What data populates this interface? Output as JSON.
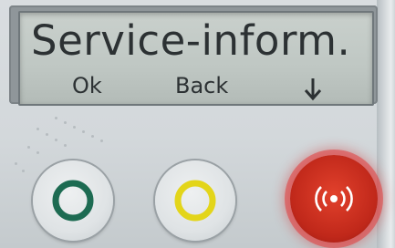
{
  "display": {
    "title": "Service-inform.",
    "softkeys": {
      "ok": "Ok",
      "back": "Back",
      "down_icon": "arrow-down-icon"
    }
  },
  "buttons": {
    "green": {
      "icon": "circle-icon",
      "color": "#1d6b52"
    },
    "yellow": {
      "icon": "circle-icon",
      "color": "#e3d51a"
    },
    "red": {
      "icon": "nfc-icon",
      "color": "#c8291b"
    }
  }
}
